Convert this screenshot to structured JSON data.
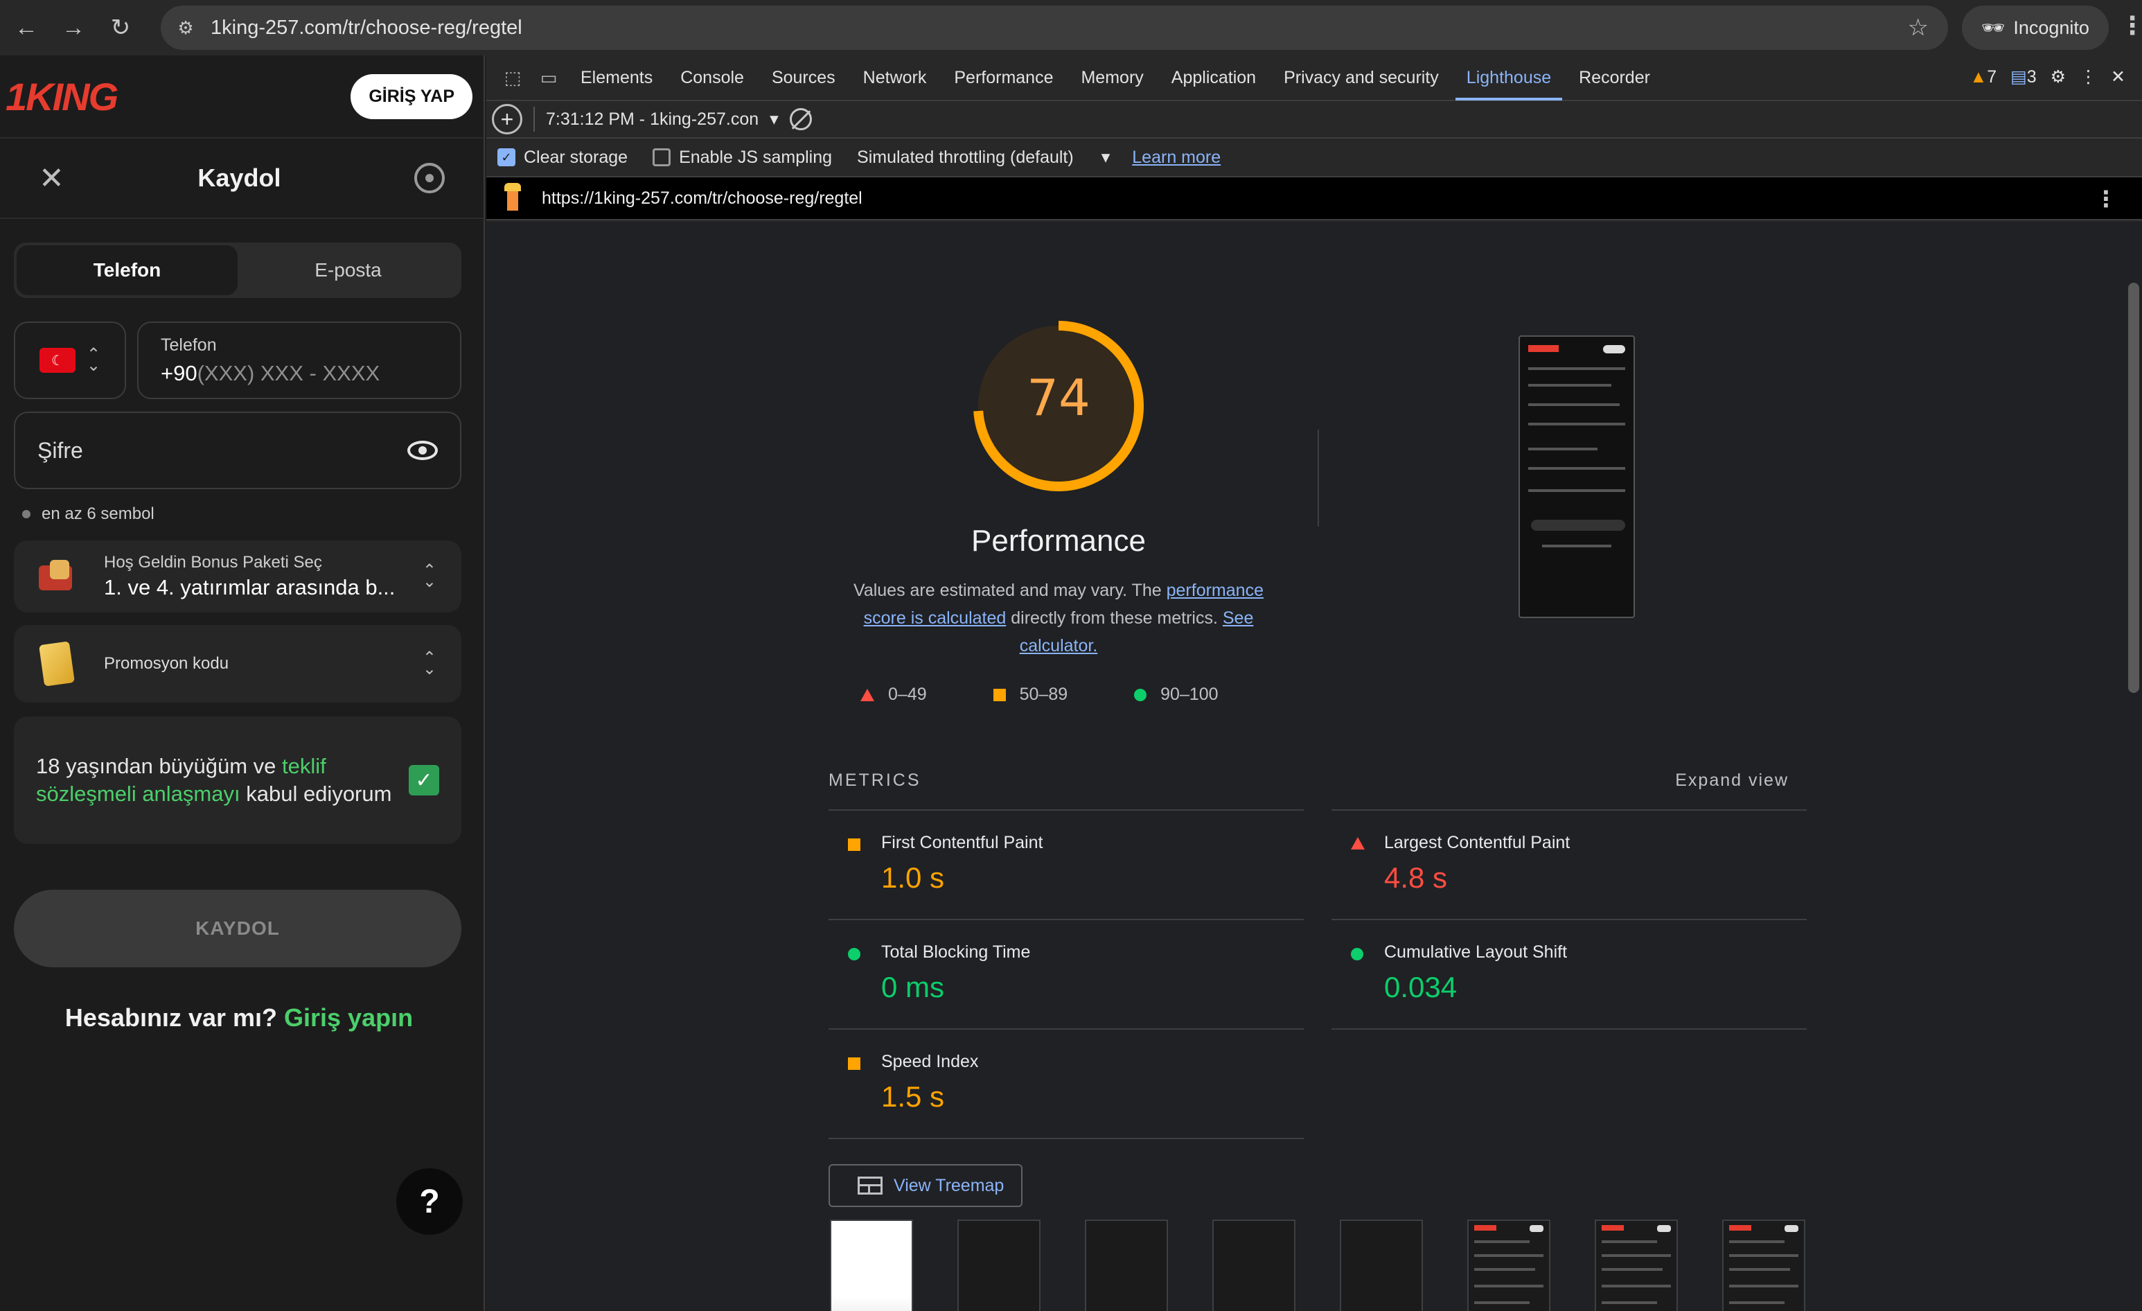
{
  "browser": {
    "url": "1king-257.com/tr/choose-reg/regtel",
    "back_icon": "←",
    "forward_icon": "→",
    "reload_icon": "↻",
    "incognito_label": "Incognito"
  },
  "site": {
    "logo": "1KING",
    "login_button": "GİRİŞ YAP",
    "title": "Kaydol",
    "tabs": [
      {
        "label": "Telefon",
        "active": true
      },
      {
        "label": "E-posta",
        "active": false
      }
    ],
    "country_flag": "☾",
    "phone_label": "Telefon",
    "phone_prefix": "+90",
    "phone_placeholder": "(XXX) XXX - XXXX",
    "password_placeholder": "Şifre",
    "password_hint": "en az 6 sembol",
    "bonus_label": "Hoş Geldin Bonus Paketi Seç",
    "bonus_value": "1. ve 4. yatırımlar arasında b...",
    "promo_label": "Promosyon kodu",
    "terms_prefix": "18 yaşından büyüğüm ve ",
    "terms_link": "teklif sözleşmeli anlaşmayı",
    "terms_suffix": " kabul ediyorum",
    "terms_checked": true,
    "submit_label": "KAYDOL",
    "have_account": "Hesabınız var mı?",
    "login_link": "Giriş yapın",
    "help_label": "?"
  },
  "devtools": {
    "tabs": [
      "Elements",
      "Console",
      "Sources",
      "Network",
      "Performance",
      "Memory",
      "Application",
      "Privacy and security",
      "Lighthouse",
      "Recorder"
    ],
    "active_tab": "Lighthouse",
    "warnings_count": "7",
    "messages_count": "3",
    "report_selector": "7:31:12 PM - 1king-257.con",
    "clear_storage_label": "Clear storage",
    "clear_storage_checked": true,
    "js_sampling_label": "Enable JS sampling",
    "js_sampling_checked": false,
    "throttling_label": "Simulated throttling (default)",
    "learn_more": "Learn more",
    "report_url": "https://1king-257.com/tr/choose-reg/regtel"
  },
  "lighthouse": {
    "score": 74,
    "score_color": "#ffa400",
    "category": "Performance",
    "desc_1": "Values are estimated and may vary. The ",
    "desc_link1": "performance score is calculated",
    "desc_2": " directly from these metrics. ",
    "desc_link2": "See calculator.",
    "legend": [
      "0–49",
      "50–89",
      "90–100"
    ],
    "metrics_heading": "METRICS",
    "expand_label": "Expand view",
    "metrics": [
      {
        "name": "First Contentful Paint",
        "value": "1.0 s",
        "rating": "average"
      },
      {
        "name": "Largest Contentful Paint",
        "value": "4.8 s",
        "rating": "fail"
      },
      {
        "name": "Total Blocking Time",
        "value": "0 ms",
        "rating": "pass"
      },
      {
        "name": "Cumulative Layout Shift",
        "value": "0.034",
        "rating": "pass"
      },
      {
        "name": "Speed Index",
        "value": "1.5 s",
        "rating": "average"
      }
    ],
    "treemap_label": "View Treemap"
  }
}
